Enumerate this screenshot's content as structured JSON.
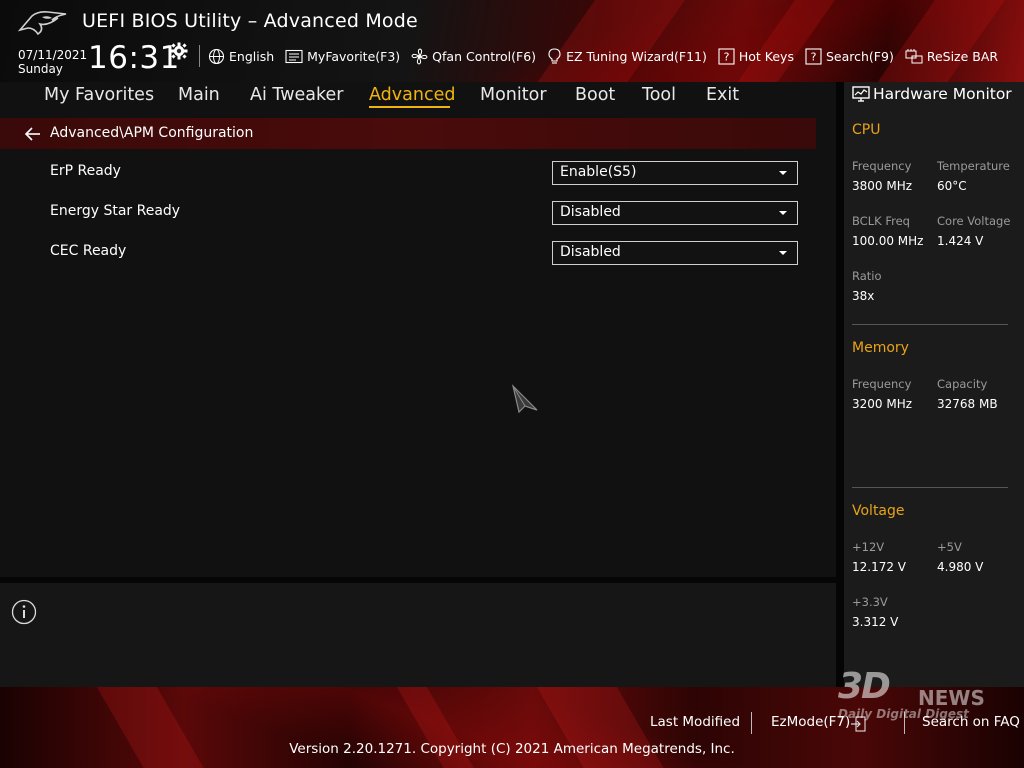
{
  "header": {
    "title": "UEFI BIOS Utility – Advanced Mode",
    "date": "07/11/2021",
    "day": "Sunday",
    "time": "16:31"
  },
  "toolbar": [
    {
      "label": "English",
      "icon": "globe-icon"
    },
    {
      "label": "MyFavorite(F3)",
      "icon": "favorite-icon"
    },
    {
      "label": "Qfan Control(F6)",
      "icon": "fan-icon"
    },
    {
      "label": "EZ Tuning Wizard(F11)",
      "icon": "bulb-icon"
    },
    {
      "label": "Hot Keys",
      "icon": "help-box-icon"
    },
    {
      "label": "Search(F9)",
      "icon": "search-box-icon"
    },
    {
      "label": "ReSize BAR",
      "icon": "resize-bar-icon"
    }
  ],
  "menu": {
    "items": [
      "My Favorites",
      "Main",
      "Ai Tweaker",
      "Advanced",
      "Monitor",
      "Boot",
      "Tool",
      "Exit"
    ],
    "active": "Advanced"
  },
  "breadcrumb": "Advanced\\APM Configuration",
  "settings": [
    {
      "label": "ErP Ready",
      "value": "Enable(S5)"
    },
    {
      "label": "Energy Star Ready",
      "value": "Disabled"
    },
    {
      "label": "CEC Ready",
      "value": "Disabled"
    }
  ],
  "hardware_monitor": {
    "title": "Hardware Monitor",
    "cpu": {
      "title": "CPU",
      "frequency_label": "Frequency",
      "frequency": "3800 MHz",
      "temperature_label": "Temperature",
      "temperature": "60°C",
      "bclk_label": "BCLK Freq",
      "bclk": "100.00 MHz",
      "core_voltage_label": "Core Voltage",
      "core_voltage": "1.424 V",
      "ratio_label": "Ratio",
      "ratio": "38x"
    },
    "memory": {
      "title": "Memory",
      "frequency_label": "Frequency",
      "frequency": "3200 MHz",
      "capacity_label": "Capacity",
      "capacity": "32768 MB"
    },
    "voltage": {
      "title": "Voltage",
      "v12_label": "+12V",
      "v12": "12.172 V",
      "v5_label": "+5V",
      "v5": "4.980 V",
      "v33_label": "+3.3V",
      "v33": "3.312 V"
    }
  },
  "footer": {
    "last_modified": "Last Modified",
    "ezmode": "EzMode(F7)",
    "search_faq": "Search on FAQ",
    "copyright": "Version 2.20.1271. Copyright (C) 2021 American Megatrends, Inc."
  },
  "watermark": {
    "main": "3D",
    "news": "NEWS",
    "sub": "Daily Digital Digest"
  },
  "colors": {
    "accent": "#f0b410",
    "section_title": "#e8a317",
    "breadcrumb_bg": "#4a0b0b"
  }
}
